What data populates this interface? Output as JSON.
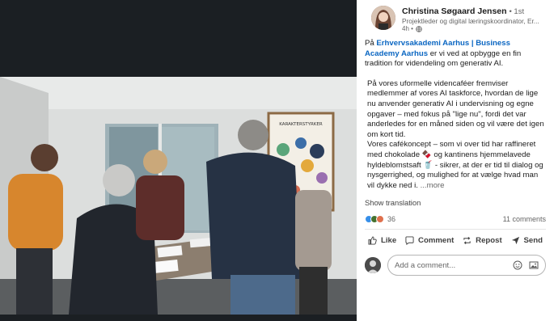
{
  "post": {
    "author": "Christina Søgaard Jensen",
    "degree": "• 1st",
    "headline": "Projektleder og digital læringskoordinator, Er...",
    "time": "4h •",
    "body": {
      "p1_prefix": "På ",
      "p1_link": "Erhvervsakademi Aarhus | Business Academy Aarhus",
      "p1_suffix": " er vi ved at opbygge en fin tradition for videndeling om generativ AI.",
      "p2": "På vores uformelle videncaféer fremviser medlemmer af vores AI taskforce, hvordan de lige nu anvender generativ AI i undervisning og egne opgaver – med fokus på \"lige nu\", fordi det var anderledes for en måned siden og vil være det igen om kort tid.",
      "p3": "Vores cafékoncept – som vi over tid har raffineret med chokolade 🍫 og kantinens hjemmelavede hyldeblomstsaft 🥤 - sikrer, at der er tid til dialog og nysgerrighed, og mulighed for at vælge hvad man vil dykke ned i.",
      "more": " ...more"
    },
    "show_translation": "Show translation",
    "reactions_count": "36",
    "comments_count": "11 comments",
    "poster_title": "KARAKTERSTYRKER"
  },
  "actions": {
    "like": "Like",
    "comment": "Comment",
    "repost": "Repost",
    "send": "Send"
  },
  "comment_box": {
    "placeholder": "Add a comment..."
  },
  "colors": {
    "link": "#0a66c2",
    "like_reaction": "#378fe9",
    "celebrate_reaction": "#44712e",
    "love_reaction": "#df704d"
  }
}
